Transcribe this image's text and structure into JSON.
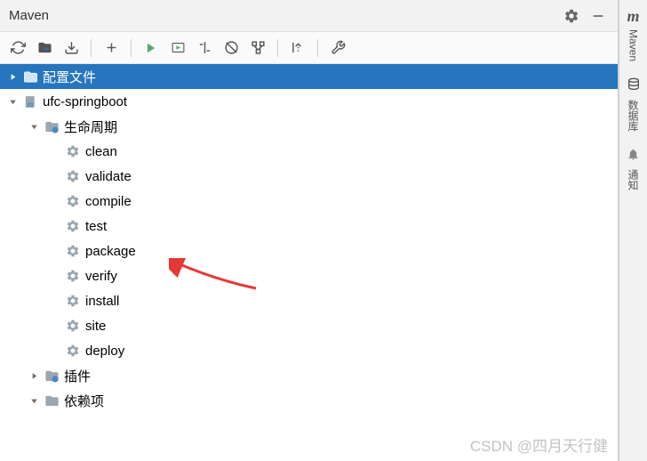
{
  "title": "Maven",
  "sideTabs": {
    "maven": {
      "icon": "m",
      "label": "Maven"
    },
    "database": {
      "label": "数据库"
    },
    "notify": {
      "label": "通知"
    }
  },
  "tree": {
    "profiles": "配置文件",
    "project": "ufc-springboot",
    "lifecycle": "生命周期",
    "phases": {
      "clean": "clean",
      "validate": "validate",
      "compile": "compile",
      "test": "test",
      "package": "package",
      "verify": "verify",
      "install": "install",
      "site": "site",
      "deploy": "deploy"
    },
    "plugins": "插件",
    "dependencies": "依赖项"
  },
  "watermark": "CSDN @四月天行健"
}
